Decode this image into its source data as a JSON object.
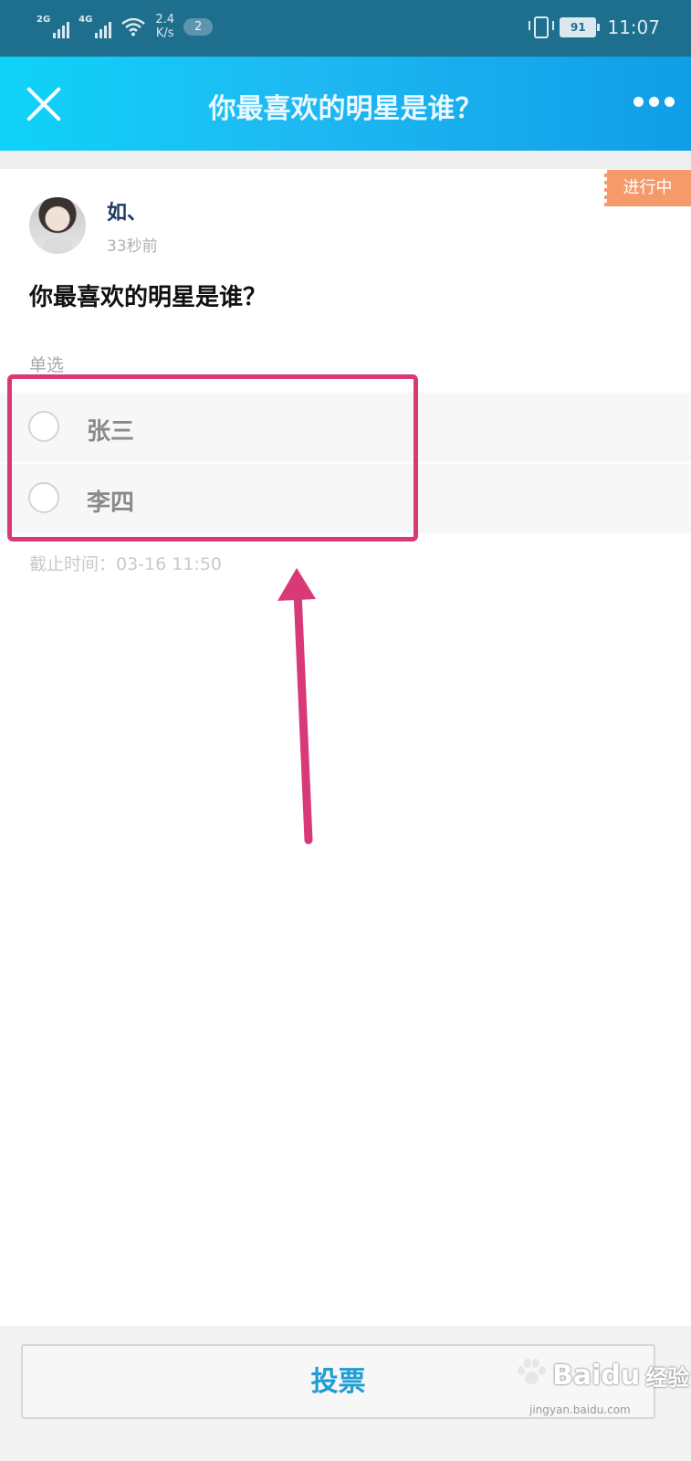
{
  "status_bar": {
    "signal1_label": "2G",
    "signal2_label": "4G",
    "net_speed_value": "2.4",
    "net_speed_unit": "K/s",
    "notification_count": "2",
    "battery": "91",
    "time": "11:07"
  },
  "header": {
    "title": "你最喜欢的明星是谁？"
  },
  "post": {
    "status_tag": "进行中",
    "author": "如、",
    "posted_ago": "33秒前",
    "question": "你最喜欢的明星是谁？",
    "vote_type": "单选",
    "options": [
      {
        "label": "张三"
      },
      {
        "label": "李四"
      }
    ],
    "deadline": "截止时间：03-16 11:50"
  },
  "footer": {
    "vote_button": "投票"
  },
  "watermark": {
    "brand": "Baidu",
    "brand_cn": "经验",
    "url": "jingyan.baidu.com"
  },
  "colors": {
    "header_gradient_start": "#0fd3f8",
    "header_gradient_end": "#0f9ee8",
    "status_tag": "#f59a6a",
    "highlight_annotation": "#d83a78",
    "vote_text": "#1e9ed4"
  }
}
